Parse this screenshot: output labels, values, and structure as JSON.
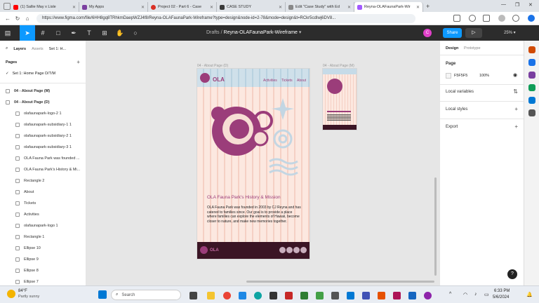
{
  "browser": {
    "tabs": [
      {
        "label": "(1) Sallie May x Lisle",
        "color": "#ff0000",
        "active": false
      },
      {
        "label": "My Apps",
        "color": "#7b3fa0",
        "active": false
      },
      {
        "label": "Project 02 - Part 6 - Case",
        "color": "#d93025",
        "active": false
      },
      {
        "label": "CASE STUDY",
        "color": "#3a3a3a",
        "active": false
      },
      {
        "label": "Edit \"Case Study\" with Ed",
        "color": "#888888",
        "active": false
      },
      {
        "label": "Reyna-OLAFaunaPark-Wir",
        "color": "#a259ff",
        "active": true
      }
    ],
    "url": "https://www.figma.com/file/6HH8gq8TRhkmDaepWZJ4f8/Reyna-OLAFaunaPark-Wireframe?type=design&node-id=2-78&mode=design&t=RCkr5cdIwj6DV8..."
  },
  "figma": {
    "breadcrumb_root": "Drafts",
    "breadcrumb_sep": "/",
    "file_name": "Reyna-OLAFaunaPark-Wireframe",
    "avatar_initial": "C",
    "share_label": "Share",
    "zoom": "25%",
    "left_tabs": {
      "layers": "Layers",
      "assets": "Assets",
      "page_selector": "Set 1: H..."
    },
    "pages_heading": "Pages",
    "current_page": "Set 1: Home Page D/T/M",
    "layers": [
      {
        "label": "04 - About Page (M)",
        "level": 0,
        "bold": true
      },
      {
        "label": "04 - About Page (D)",
        "level": 0,
        "bold": true
      },
      {
        "label": "olafaunapark-logo-2 1",
        "level": 1
      },
      {
        "label": "olafaunapark-subsidiary-1 1",
        "level": 1
      },
      {
        "label": "olafaunapark-subsidiary-2 1",
        "level": 1
      },
      {
        "label": "olafaunapark-subsidiary-3 1",
        "level": 1
      },
      {
        "label": "OLA Fauna Park was founded ...",
        "level": 1
      },
      {
        "label": "OLA Fauna Park's History & Mi...",
        "level": 1
      },
      {
        "label": "Rectangle 2",
        "level": 1
      },
      {
        "label": "About",
        "level": 1
      },
      {
        "label": "Tickets",
        "level": 1
      },
      {
        "label": "Activities",
        "level": 1
      },
      {
        "label": "olafaunapark-logo 1",
        "level": 1
      },
      {
        "label": "Rectangle 1",
        "level": 1
      },
      {
        "label": "Ellipse 10",
        "level": 1
      },
      {
        "label": "Ellipse 9",
        "level": 1
      },
      {
        "label": "Ellipse 8",
        "level": 1
      },
      {
        "label": "Ellipse 7",
        "level": 1
      }
    ],
    "right_tabs": {
      "design": "Design",
      "prototype": "Prototype"
    },
    "page_section": {
      "title": "Page",
      "color_hex": "F5F5F5",
      "opacity": "100%"
    },
    "local_variables": "Local variables",
    "local_styles": "Local styles",
    "export": "Export"
  },
  "frames": {
    "desktop_label": "04 - About Page (D)",
    "mobile_label": "04 - About Page (M)",
    "logo_text": "OLA",
    "nav": [
      "Activities",
      "Tickets",
      "About"
    ],
    "heading": "OLA Fauna Park's History & Mission",
    "body": "OLA Fauna Park was founded in 2003 by CJ Reyna and has catered to families since. Our goal is to provide a place where families can explore the elements of Hawaii, become closer to nature, and make new memories together.",
    "footer_logo": "OLA"
  },
  "taskbar": {
    "weather_temp": "84°F",
    "weather_desc": "Partly sunny",
    "search_placeholder": "Search",
    "time": "6:33 PM",
    "date": "5/6/2024"
  },
  "colors": {
    "accent": "#0d99ff",
    "brand": "#9b3d7a",
    "stripe": "#f7d9cf",
    "header": "#c6dbe8",
    "footer": "#3b1525"
  }
}
